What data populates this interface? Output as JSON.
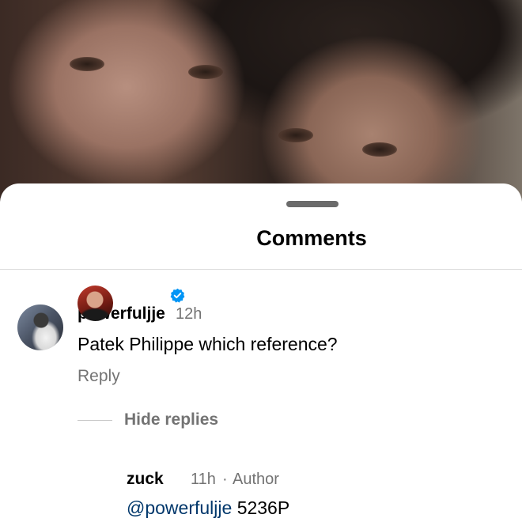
{
  "sheet": {
    "title": "Comments"
  },
  "comments": [
    {
      "username": "powerfuljje",
      "time": "12h",
      "text": "Patek Philippe which reference?",
      "reply_label": "Reply"
    }
  ],
  "replies_toggle": {
    "label": "Hide replies"
  },
  "replies": [
    {
      "username": "zuck",
      "verified": true,
      "time": "11h",
      "separator": "·",
      "author_tag": "Author",
      "mention": "@powerfuljje",
      "text": "5236P"
    }
  ],
  "colors": {
    "secondary_text": "#737373",
    "mention": "#00376b",
    "verified_badge": "#0095f6"
  },
  "icons": [
    "verified-badge-icon"
  ]
}
